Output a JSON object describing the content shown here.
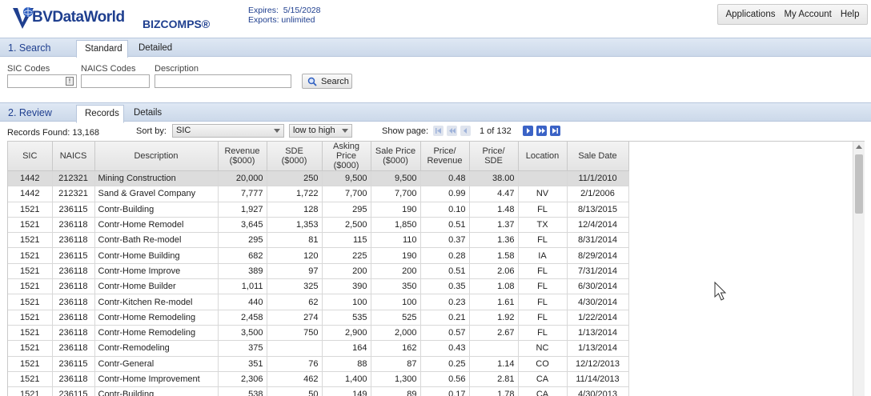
{
  "header": {
    "logo_text": "BVDataWorld",
    "product": "BIZCOMPS®",
    "expires": "Expires:  5/15/2028",
    "exports": "Exports: unlimited",
    "nav": [
      "Applications",
      "My Account",
      "Help"
    ]
  },
  "search": {
    "section_title": "1. Search",
    "tabs": [
      "Standard",
      "Detailed"
    ],
    "sic_label": "SIC Codes",
    "naics_label": "NAICS Codes",
    "description_label": "Description",
    "sic_value": "",
    "naics_value": "",
    "description_value": "",
    "button_label": "Search"
  },
  "review": {
    "section_title": "2. Review",
    "tabs": [
      "Records",
      "Details"
    ],
    "records_found": "Records Found: 13,168",
    "sort_by_label": "Sort by:",
    "sort_field": "SIC",
    "sort_order": "low to high",
    "show_page_label": "Show page:",
    "page_info": "1 of 132"
  },
  "table": {
    "columns": [
      [
        "SIC"
      ],
      [
        "NAICS"
      ],
      [
        "Description"
      ],
      [
        "Revenue",
        "($000)"
      ],
      [
        "SDE",
        "($000)"
      ],
      [
        "Asking Price",
        "($000)"
      ],
      [
        "Sale Price",
        "($000)"
      ],
      [
        "Price/",
        "Revenue"
      ],
      [
        "Price/",
        "SDE"
      ],
      [
        "Location"
      ],
      [
        "Sale Date"
      ]
    ],
    "rows": [
      [
        "1442",
        "212321",
        "Mining Construction",
        "20,000",
        "250",
        "9,500",
        "9,500",
        "0.48",
        "38.00",
        "",
        "11/1/2010"
      ],
      [
        "1442",
        "212321",
        "Sand & Gravel Company",
        "7,777",
        "1,722",
        "7,700",
        "7,700",
        "0.99",
        "4.47",
        "NV",
        "2/1/2006"
      ],
      [
        "1521",
        "236115",
        "Contr-Building",
        "1,927",
        "128",
        "295",
        "190",
        "0.10",
        "1.48",
        "FL",
        "8/13/2015"
      ],
      [
        "1521",
        "236118",
        "Contr-Home Remodel",
        "3,645",
        "1,353",
        "2,500",
        "1,850",
        "0.51",
        "1.37",
        "TX",
        "12/4/2014"
      ],
      [
        "1521",
        "236118",
        "Contr-Bath Re-model",
        "295",
        "81",
        "115",
        "110",
        "0.37",
        "1.36",
        "FL",
        "8/31/2014"
      ],
      [
        "1521",
        "236115",
        "Contr-Home Building",
        "682",
        "120",
        "225",
        "190",
        "0.28",
        "1.58",
        "IA",
        "8/29/2014"
      ],
      [
        "1521",
        "236118",
        "Contr-Home Improve",
        "389",
        "97",
        "200",
        "200",
        "0.51",
        "2.06",
        "FL",
        "7/31/2014"
      ],
      [
        "1521",
        "236118",
        "Contr-Home Builder",
        "1,011",
        "325",
        "390",
        "350",
        "0.35",
        "1.08",
        "FL",
        "6/30/2014"
      ],
      [
        "1521",
        "236118",
        "Contr-Kitchen Re-model",
        "440",
        "62",
        "100",
        "100",
        "0.23",
        "1.61",
        "FL",
        "4/30/2014"
      ],
      [
        "1521",
        "236118",
        "Contr-Home Remodeling",
        "2,458",
        "274",
        "535",
        "525",
        "0.21",
        "1.92",
        "FL",
        "1/22/2014"
      ],
      [
        "1521",
        "236118",
        "Contr-Home Remodeling",
        "3,500",
        "750",
        "2,900",
        "2,000",
        "0.57",
        "2.67",
        "FL",
        "1/13/2014"
      ],
      [
        "1521",
        "236118",
        "Contr-Remodeling",
        "375",
        "",
        "164",
        "162",
        "0.43",
        "",
        "NC",
        "1/13/2014"
      ],
      [
        "1521",
        "236115",
        "Contr-General",
        "351",
        "76",
        "88",
        "87",
        "0.25",
        "1.14",
        "CO",
        "12/12/2013"
      ],
      [
        "1521",
        "236118",
        "Contr-Home Improvement",
        "2,306",
        "462",
        "1,400",
        "1,300",
        "0.56",
        "2.81",
        "CA",
        "11/14/2013"
      ],
      [
        "1521",
        "236115",
        "Contr-Building",
        "538",
        "50",
        "149",
        "89",
        "0.17",
        "1.78",
        "CA",
        "4/30/2013"
      ]
    ]
  }
}
